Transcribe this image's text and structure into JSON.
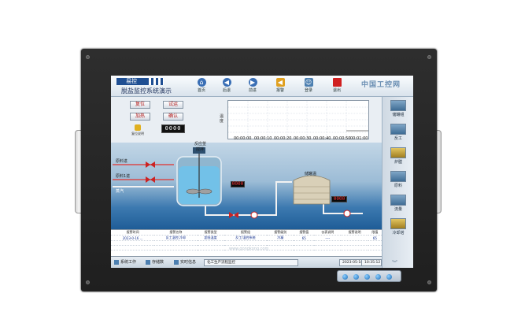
{
  "toolbar": {
    "logo_badge": "易控",
    "logo_title": "脱盐监控系统演示",
    "buttons": [
      {
        "label": "首页",
        "icon": "home-icon",
        "color": "#3a6fb5"
      },
      {
        "label": "后退",
        "icon": "back-icon",
        "color": "#3a6fb5"
      },
      {
        "label": "前进",
        "icon": "forward-icon",
        "color": "#3a6fb5"
      },
      {
        "label": "报警",
        "icon": "alarm-icon",
        "color": "#e0a020"
      },
      {
        "label": "登录",
        "icon": "login-icon",
        "color": "#4c7fb0"
      },
      {
        "label": "退出",
        "icon": "exit-icon",
        "color": "#d02020"
      }
    ],
    "watermark": "中国工控网"
  },
  "control_panel": {
    "buttons": [
      "复位",
      "试运",
      "加热",
      "确认"
    ],
    "counter": "0000",
    "reset_label": "复位说明",
    "trend_axis_label": "温度",
    "trend_time_labels": [
      "00:00:00",
      "00:00:10",
      "00:00:20",
      "00:00:30",
      "00:00:40",
      "00:00:50",
      "00:01:00"
    ]
  },
  "process": {
    "reactor_label": "反应釜",
    "reactor_sub": "搅拌",
    "tank_label": "储罐温",
    "feed_labels": [
      "原料进",
      "原料1进",
      "蒸汽"
    ],
    "display_reactor": "0000",
    "display_tank": "0000"
  },
  "sidebar": {
    "items": [
      {
        "label": "储罐组"
      },
      {
        "label": "反工"
      },
      {
        "label": "炉膛"
      },
      {
        "label": "原料"
      },
      {
        "label": "流量"
      },
      {
        "label": "冷却塔"
      }
    ],
    "more": "︾"
  },
  "alarm_table": {
    "headers": [
      "报警时间",
      "报警名称",
      "报警类型",
      "报警组",
      "报警级别",
      "报警值",
      "仪表说明",
      "报警说明",
      "限值"
    ],
    "rows": [
      [
        "2023-0-16 ...",
        "反工温控,冷却",
        "超低温度",
        "反工/温控系统",
        "冷凝",
        "65",
        "----",
        "",
        "65"
      ]
    ],
    "watermark": "www.gongkong.com"
  },
  "status_bar": {
    "buttons": [
      "系统工作",
      "存储数",
      "实时信息"
    ],
    "message": "化工生产流程监控",
    "date": "2023-05-18",
    "time": "10:35:12"
  }
}
